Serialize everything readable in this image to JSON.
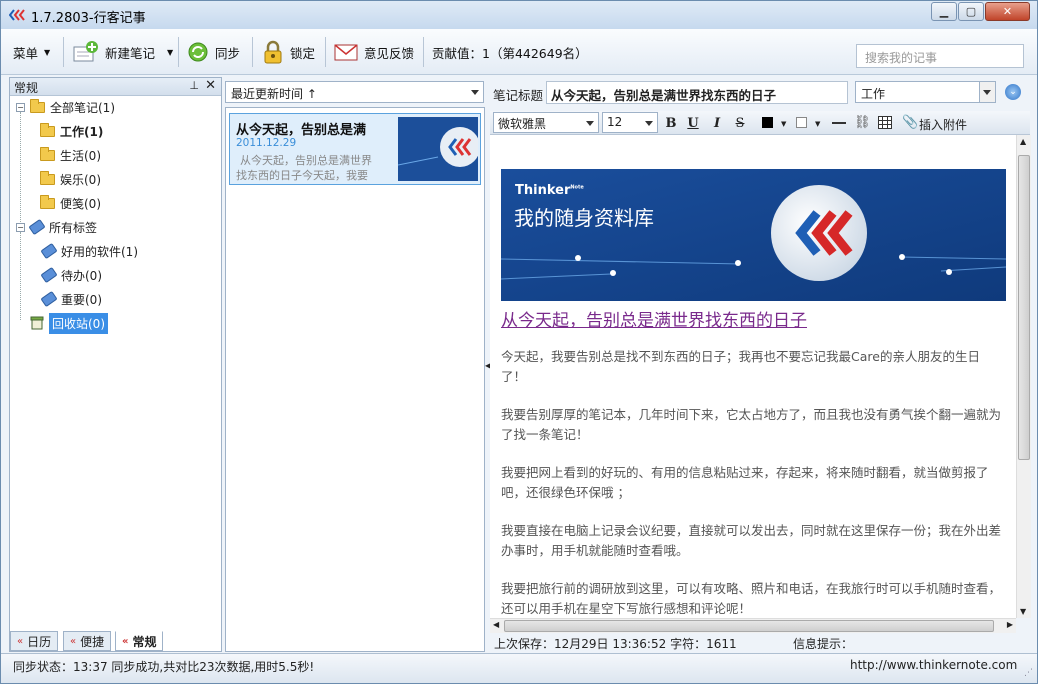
{
  "window": {
    "title": "1.7.2803-行客记事"
  },
  "toolbar": {
    "menu_label": "菜单",
    "new_note_label": "新建笔记",
    "sync_label": "同步",
    "lock_label": "锁定",
    "feedback_label": "意见反馈",
    "contribution": "贡献值：1（第442649名）",
    "search_placeholder": "搜索我的记事"
  },
  "sidebar": {
    "header": "常规",
    "all_notes": "全部笔记(1)",
    "folders": [
      {
        "label": "工作(1)"
      },
      {
        "label": "生活(0)"
      },
      {
        "label": "娱乐(0)"
      },
      {
        "label": "便笺(0)"
      }
    ],
    "all_tags": "所有标签",
    "tags": [
      {
        "label": "好用的软件(1)"
      },
      {
        "label": "待办(0)"
      },
      {
        "label": "重要(0)"
      }
    ],
    "trash": "回收站(0)",
    "bottom_tabs": [
      {
        "label": "日历"
      },
      {
        "label": "便捷"
      },
      {
        "label": "常规"
      }
    ]
  },
  "note_list": {
    "sort_label": "最近更新时间 ↑",
    "items": [
      {
        "title": "从今天起，告别总是满",
        "date": "2011.12.29",
        "preview_1": "从今天起，告别总是满世界",
        "preview_2": "找东西的日子今天起，我要"
      }
    ]
  },
  "editor": {
    "title_label": "笔记标题",
    "title_value": "从今天起，告别总是满世界找东西的日子",
    "category": "工作",
    "font_family": "微软雅黑",
    "font_size": "12",
    "insert_attachment": "插入附件",
    "banner_brand": "Thinker",
    "banner_brand_sup": "Note",
    "banner_text": "我的随身资料库",
    "heading_link": "从今天起，告别总是满世界找东西的日子",
    "paragraphs": [
      "今天起，我要告别总是找不到东西的日子；我再也不要忘记我最Care的亲人朋友的生日了！",
      "我要告别厚厚的笔记本，几年时间下来，它太占地方了，而且我也没有勇气挨个翻一遍就为了找一条笔记！",
      "我要把网上看到的好玩的、有用的信息粘贴过来，存起来，将来随时翻看，就当做剪报了吧，还很绿色环保哦 ；",
      "我要直接在电脑上记录会议纪要，直接就可以发出去，同时就在这里保存一份；我在外出差办事时，用手机就能随时查看哦。",
      "我要把旅行前的调研放到这里，可以有攻略、照片和电话，在我旅行时可以手机随时查看，还可以用手机在星空下写旅行感想和评论呢！"
    ],
    "last_saved": "上次保存：12月29日 13:36:52 字符：1611",
    "info_hint": "信息提示："
  },
  "status": {
    "sync_status": "同步状态：13:37 同步成功,共对比23次数据,用时5.5秒!",
    "url": "http://www.thinkernote.com"
  },
  "colors": {
    "accent": "#3a78c8",
    "banner_bg": "#1c4f9a",
    "link": "#7a2a8c"
  }
}
